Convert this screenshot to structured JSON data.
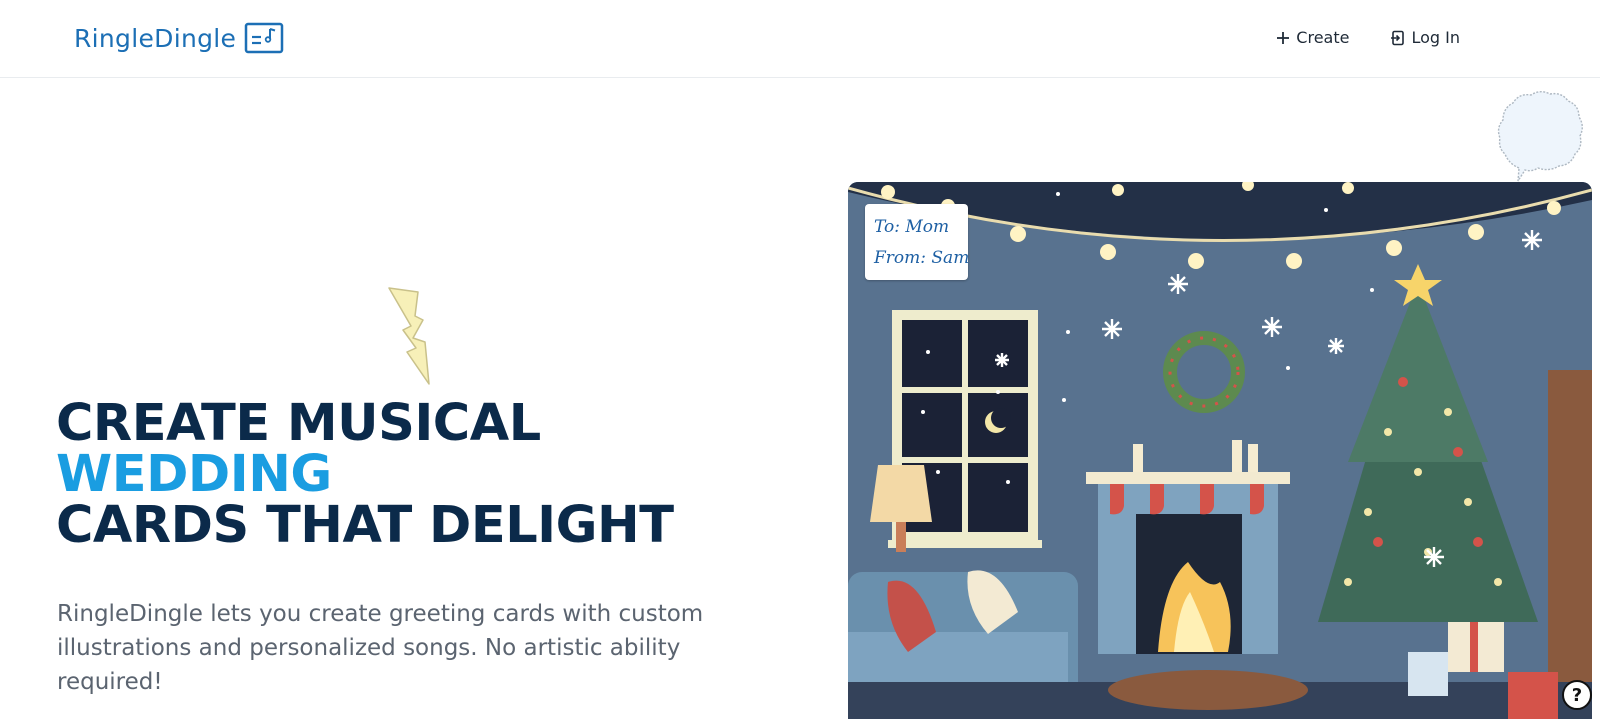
{
  "header": {
    "brand_name": "RingleDingle",
    "brand_icon": "music-card-icon",
    "nav": {
      "create_label": "Create",
      "create_icon": "plus-icon",
      "login_label": "Log In",
      "login_icon": "login-icon"
    }
  },
  "hero": {
    "title_line1": "CREATE MUSICAL",
    "title_line2": "WEDDING",
    "title_line3": "CARDS THAT DELIGHT",
    "description": "RingleDingle lets you create greeting cards with custom illustrations and personalized songs. No artistic ability required!"
  },
  "card": {
    "tag_to": "To: Mom",
    "tag_from": "From: Sam",
    "illustration": "christmas-living-room-illustration"
  },
  "help_button": {
    "label": "?",
    "icon": "help-icon"
  },
  "colors": {
    "brand": "#1c6fb5",
    "title": "#0b2a4a",
    "accent": "#1a9de1",
    "body_text": "#5b6470"
  }
}
